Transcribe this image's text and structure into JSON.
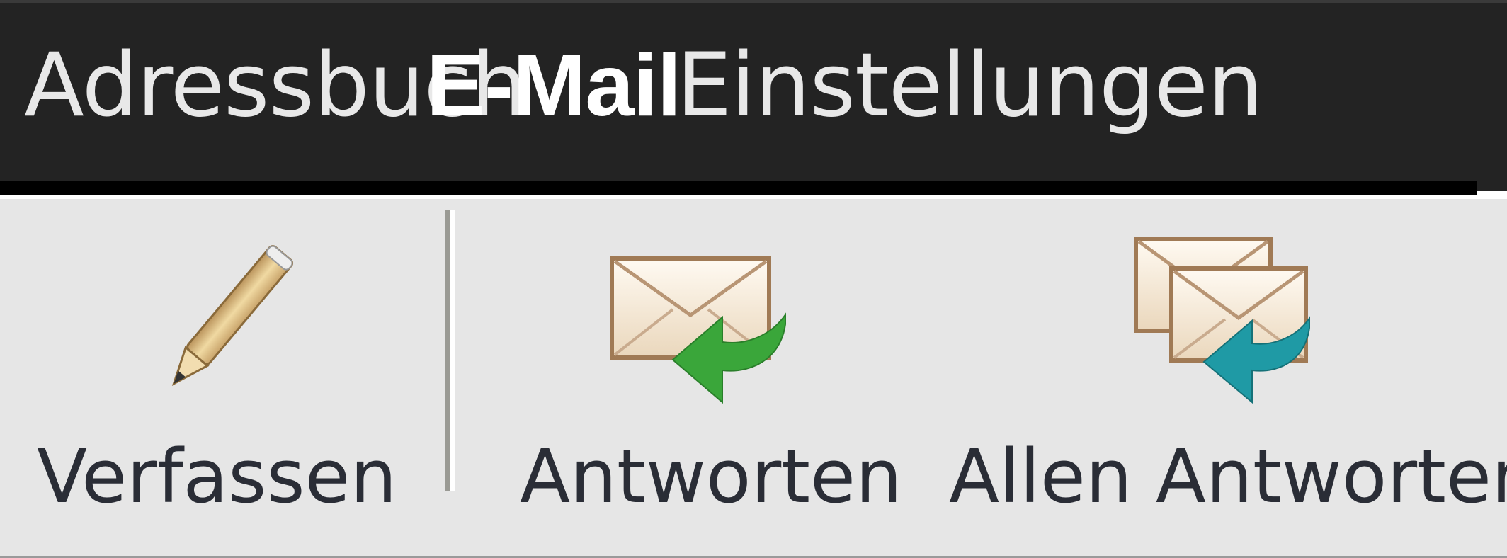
{
  "nav": {
    "items": [
      {
        "label": "Adressbuch",
        "active": false
      },
      {
        "label": "E-Mail",
        "active": true
      },
      {
        "label": "Einstellungen",
        "active": false
      }
    ]
  },
  "toolbar": {
    "compose_label": "Verfassen",
    "reply_label": "Antworten",
    "reply_all_label": "Allen Antworten"
  },
  "icons": {
    "compose": "pencil-icon",
    "reply": "reply-envelope-icon",
    "reply_all": "reply-all-envelopes-icon"
  },
  "colors": {
    "topbar_bg": "#232323",
    "toolbar_bg": "#e6e6e6",
    "nav_text": "#e8e8e8",
    "label_text": "#2a2d36",
    "reply_arrow": "#3aa63a",
    "reply_all_arrow": "#1f9aa5"
  }
}
